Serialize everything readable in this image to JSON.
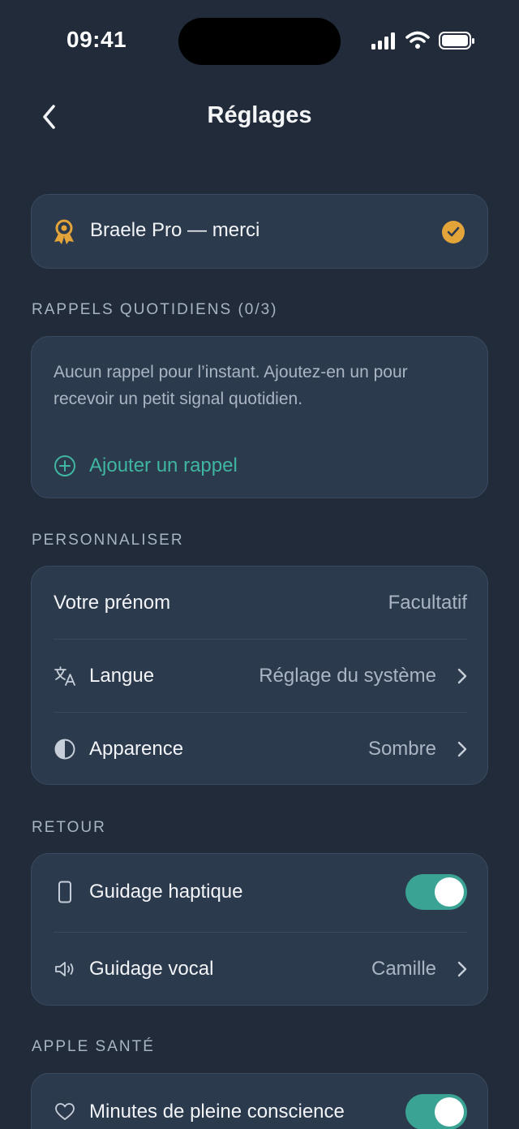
{
  "status_bar": {
    "time": "09:41"
  },
  "nav": {
    "title": "Réglages"
  },
  "pro": {
    "label": "Braele Pro — merci"
  },
  "reminders": {
    "section_label": "RAPPELS QUOTIDIENS (0/3)",
    "empty_text": "Aucun rappel pour l’instant. Ajoutez-en un pour recevoir un petit signal quotidien.",
    "add_label": "Ajouter un rappel"
  },
  "personnaliser": {
    "section_label": "PERSONNALISER",
    "name_title": "Votre prénom",
    "name_placeholder": "Facultatif",
    "language_title": "Langue",
    "language_value": "Réglage du système",
    "appearance_title": "Apparence",
    "appearance_value": "Sombre"
  },
  "retour": {
    "section_label": "RETOUR",
    "haptic_title": "Guidage haptique",
    "haptic_on": true,
    "voice_title": "Guidage vocal",
    "voice_value": "Camille"
  },
  "sante": {
    "section_label": "APPLE SANTÉ",
    "mindful_title": "Minutes de pleine conscience",
    "mindful_on": true
  },
  "colors": {
    "background": "#212b3a",
    "card": "#2c3a4d",
    "accent_teal": "#3fb5a3",
    "pro_gold": "#e3a43a"
  },
  "icons": {
    "pro": "award-badge-icon",
    "check": "check-circle-icon",
    "add": "plus-circle-icon",
    "language": "translate-icon",
    "appearance": "contrast-icon",
    "haptic": "phone-icon",
    "voice": "speaker-icon",
    "health": "heart-icon"
  }
}
